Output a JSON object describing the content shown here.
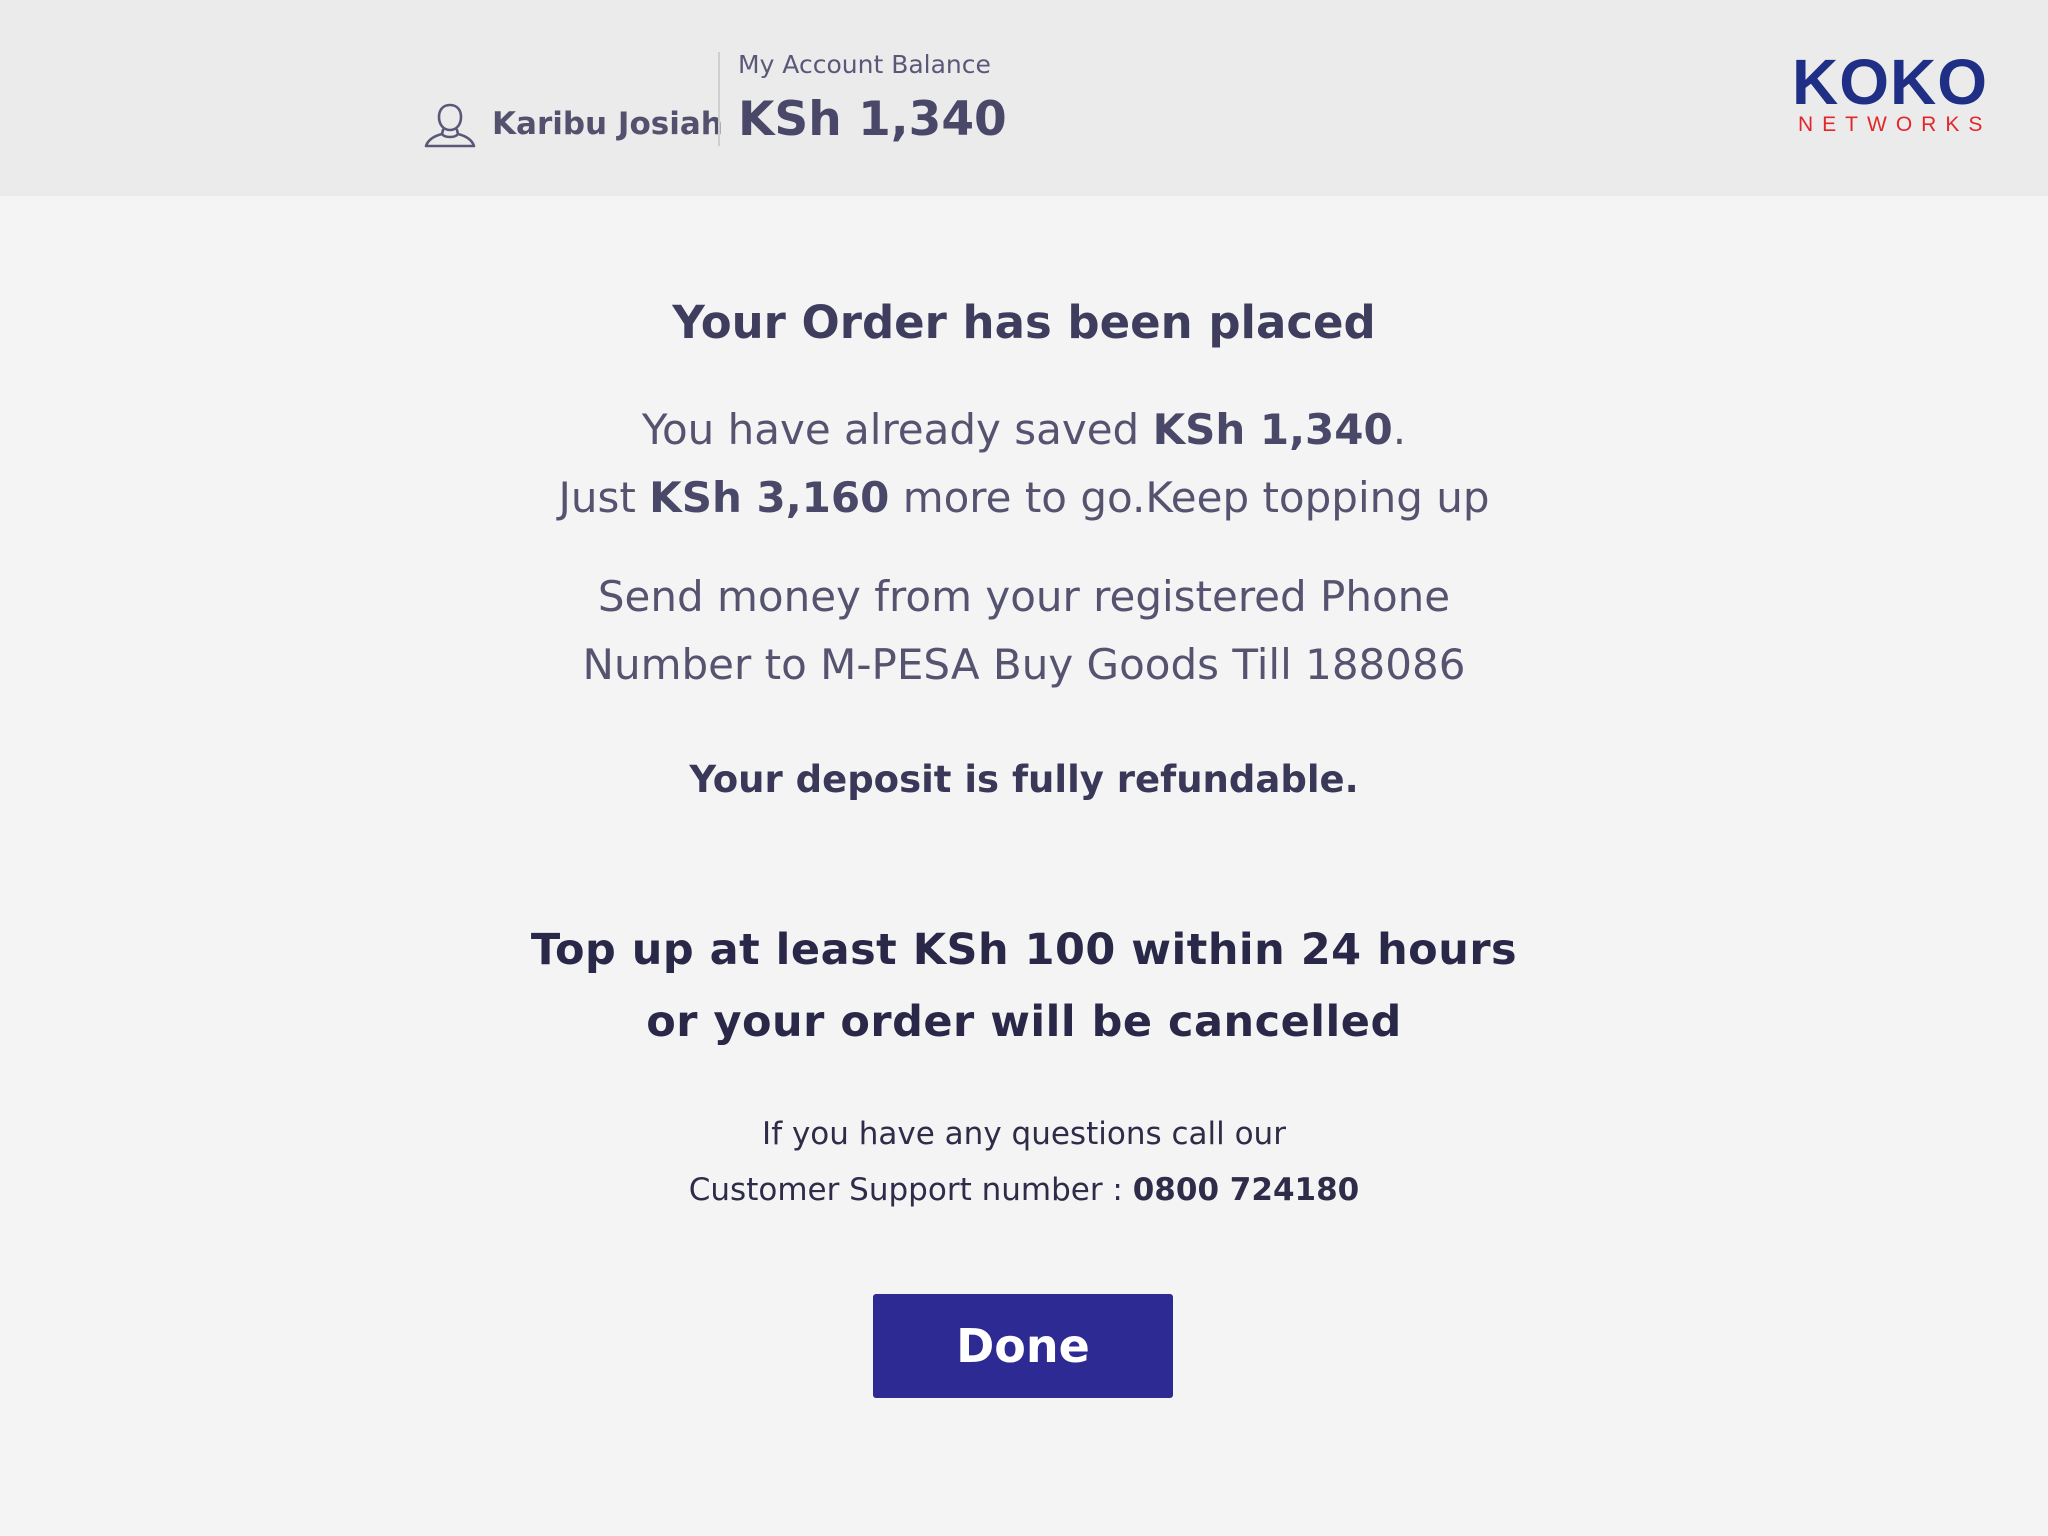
{
  "header": {
    "user_name": "Karibu Josiah",
    "balance_label": "My Account Balance",
    "balance_value": "KSh 1,340",
    "logo_main": "KOKO",
    "logo_sub": "NETWORKS"
  },
  "main": {
    "title": "Your Order has been placed",
    "saved_prefix": "You have already saved ",
    "saved_amount": "KSh 1,340",
    "saved_suffix": ".",
    "remaining_prefix": "Just ",
    "remaining_amount": "KSh 3,160",
    "remaining_suffix": " more to go.Keep topping up",
    "send_money_line1": "Send money from your registered Phone",
    "send_money_line2": "Number to M-PESA Buy Goods Till 188086",
    "refund_note": "Your deposit is fully refundable.",
    "topup_line1": "Top up at least KSh 100 within 24 hours",
    "topup_line2": "or your order will be cancelled",
    "support_line1": "If you have any questions call our",
    "support_line2_prefix": "Customer Support number : ",
    "support_number": "0800 724180",
    "done_label": "Done"
  },
  "colors": {
    "brand_blue": "#1f2f86",
    "brand_red": "#e3262b",
    "button_bg": "#2e2a93",
    "header_bg": "#ebebeb",
    "page_bg": "#f4f4f4"
  },
  "icons": {
    "user": "user-icon"
  }
}
